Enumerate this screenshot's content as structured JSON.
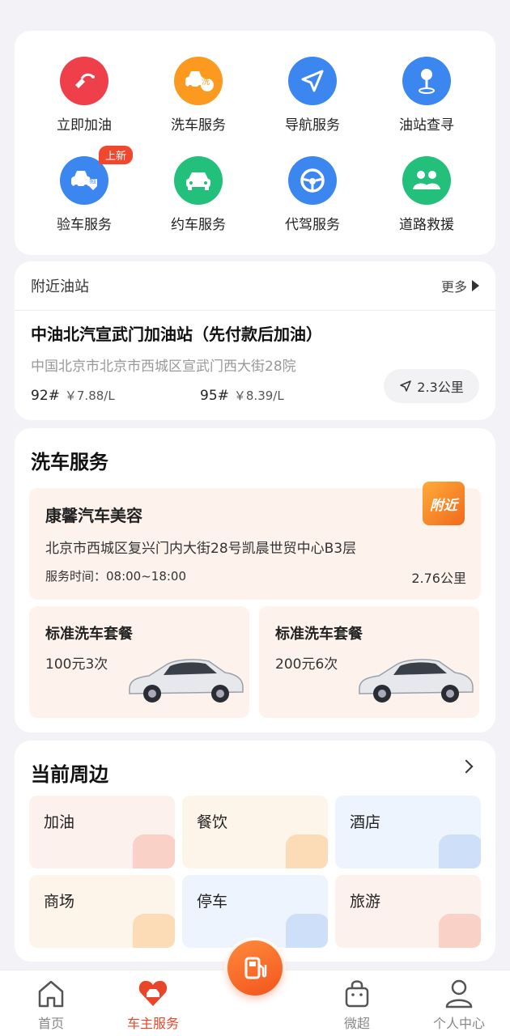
{
  "services": [
    {
      "label": "立即加油",
      "icon": "fuel-nozzle-icon",
      "color": "#ef3f4a"
    },
    {
      "label": "洗车服务",
      "icon": "car-wash-icon",
      "color": "#fb9a1e"
    },
    {
      "label": "导航服务",
      "icon": "navigation-icon",
      "color": "#3c86f0"
    },
    {
      "label": "油站查寻",
      "icon": "location-pin-icon",
      "color": "#3c86f0"
    },
    {
      "label": "验车服务",
      "icon": "car-inspection-icon",
      "color": "#3c86f0"
    },
    {
      "label": "约车服务",
      "icon": "car-booking-icon",
      "color": "#22c07a"
    },
    {
      "label": "代驾服务",
      "icon": "steering-wheel-icon",
      "color": "#3c86f0"
    },
    {
      "label": "道路救援",
      "icon": "road-rescue-icon",
      "color": "#22c07a"
    }
  ],
  "new_badge": "上新",
  "wash_glyph": "洗",
  "inspect_glyph": "验",
  "station": {
    "header": "附近油站",
    "more": "更多",
    "name": "中油北汽宣武门加油站（先付款后加油）",
    "address": "中国北京市北京市西城区宣武门西大街28院",
    "prices": [
      {
        "grade": "92#",
        "value": "￥7.88/L"
      },
      {
        "grade": "95#",
        "value": "￥8.39/L"
      }
    ],
    "distance": "2.3公里"
  },
  "wash": {
    "title": "洗车服务",
    "tag": "附近",
    "shop_name": "康馨汽车美容",
    "shop_address": "北京市西城区复兴门内大街28号凯晨世贸中心B3层",
    "hours": "服务时间：08:00~18:00",
    "distance": "2.76公里",
    "packages": [
      {
        "name": "标准洗车套餐",
        "price": "100元3次"
      },
      {
        "name": "标准洗车套餐",
        "price": "200元6次"
      }
    ]
  },
  "around": {
    "title": "当前周边",
    "categories": [
      {
        "label": "加油",
        "bg": "#fdf1ee",
        "accent": "#f7b6a8"
      },
      {
        "label": "餐饮",
        "bg": "#fdf4ea",
        "accent": "#f9c98c"
      },
      {
        "label": "酒店",
        "bg": "#eef4fd",
        "accent": "#b3cdf5"
      },
      {
        "label": "商场",
        "bg": "#fdf4ea",
        "accent": "#f9c98c"
      },
      {
        "label": "停车",
        "bg": "#eef4fd",
        "accent": "#b3cdf5"
      },
      {
        "label": "旅游",
        "bg": "#fdf1ee",
        "accent": "#f7b6a8"
      }
    ]
  },
  "tabs": [
    {
      "label": "首页",
      "icon": "home-icon"
    },
    {
      "label": "车主服务",
      "icon": "car-heart-icon",
      "active": true
    },
    {
      "label": "",
      "icon": "fuel-station-fab-icon"
    },
    {
      "label": "微超",
      "icon": "shopping-bag-icon"
    },
    {
      "label": "个人中心",
      "icon": "user-icon"
    }
  ]
}
